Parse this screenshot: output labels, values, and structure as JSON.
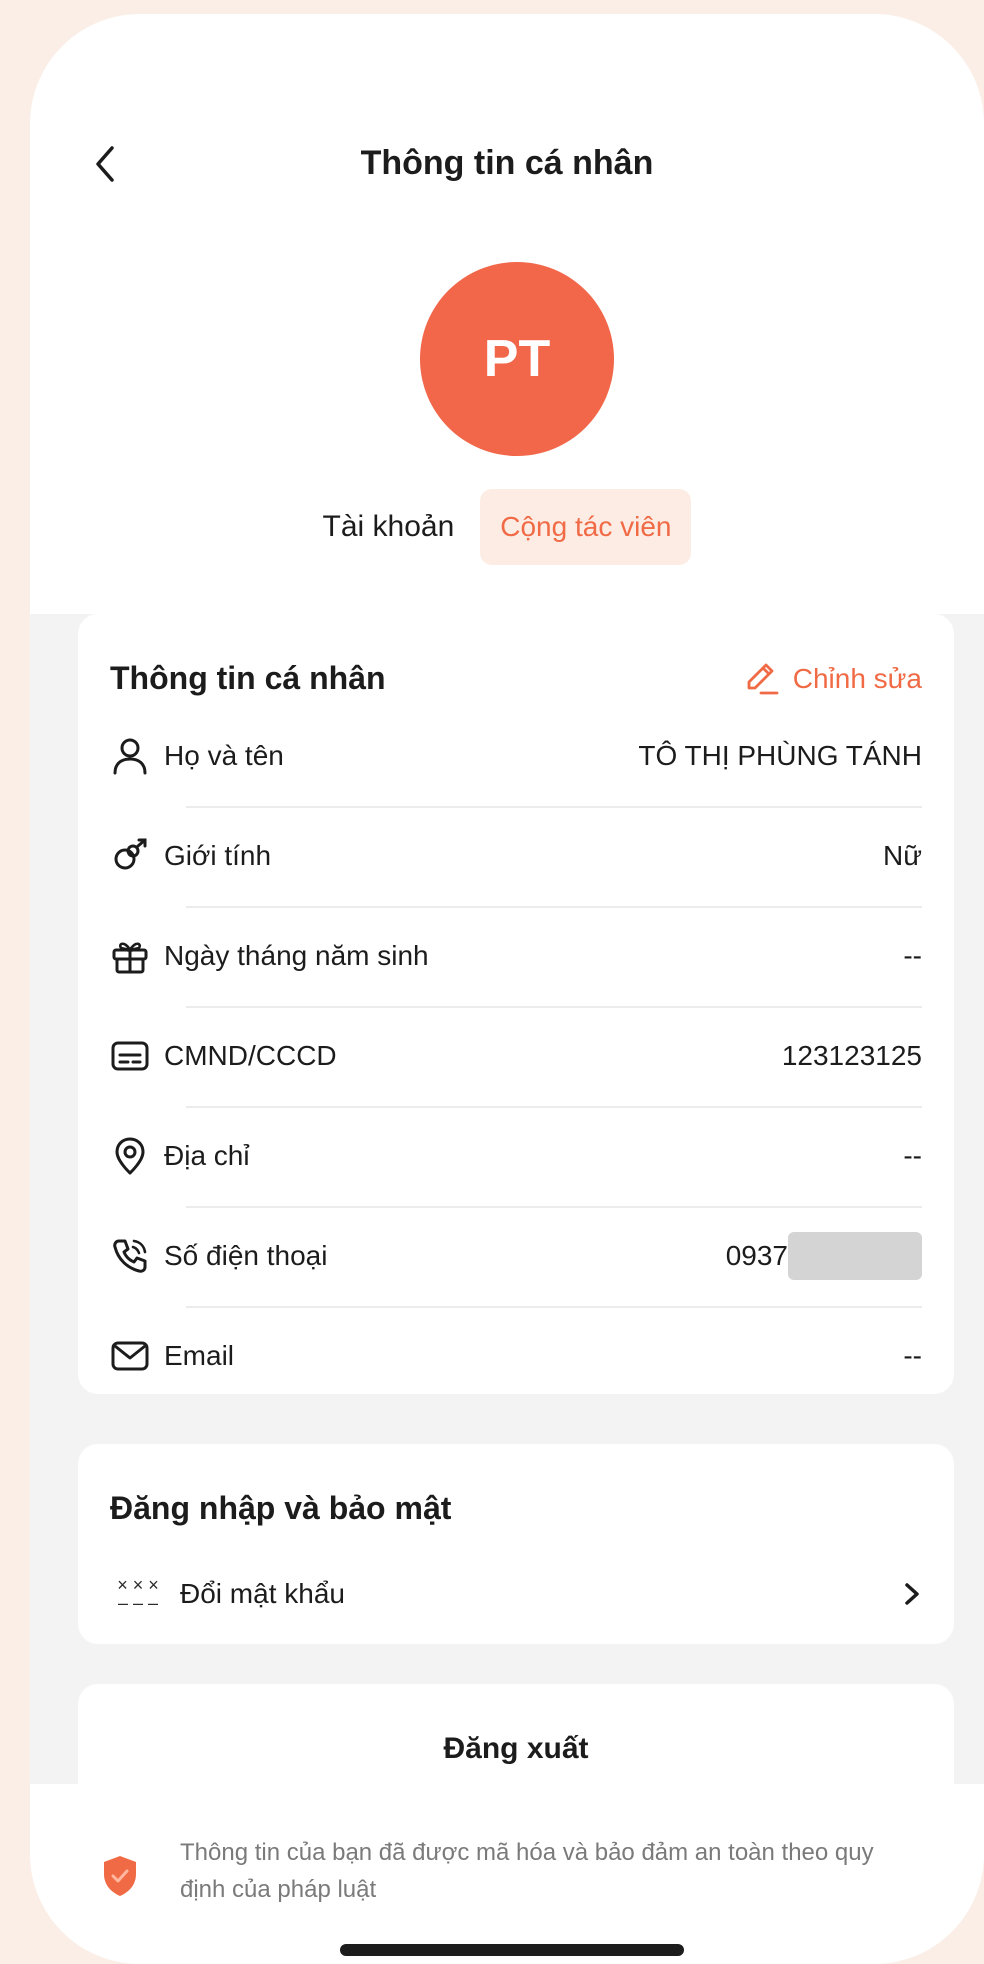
{
  "header": {
    "title": "Thông tin cá nhân",
    "back_icon": "chevron-left-icon"
  },
  "profile": {
    "initials": "PT",
    "account_label": "Tài khoản",
    "account_type": "Cộng tác viên",
    "avatar_color": "#f26649"
  },
  "personal_info": {
    "title": "Thông tin cá nhân",
    "edit_label": "Chỉnh sửa",
    "rows": [
      {
        "icon": "user-icon",
        "label": "Họ và tên",
        "value": "TÔ THỊ PHÙNG TÁNH"
      },
      {
        "icon": "gender-icon",
        "label": "Giới tính",
        "value": "Nữ"
      },
      {
        "icon": "gift-icon",
        "label": "Ngày tháng năm sinh",
        "value": "--"
      },
      {
        "icon": "id-card-icon",
        "label": "CMND/CCCD",
        "value": "123123125"
      },
      {
        "icon": "location-icon",
        "label": "Địa chỉ",
        "value": "--"
      },
      {
        "icon": "phone-icon",
        "label": "Số điện thoại",
        "value": "0937"
      },
      {
        "icon": "mail-icon",
        "label": "Email",
        "value": "--"
      }
    ]
  },
  "security": {
    "title": "Đăng nhập và bảo mật",
    "change_password": "Đổi mật khẩu"
  },
  "logout": {
    "label": "Đăng xuất"
  },
  "footer": {
    "text": "Thông tin của bạn đã được mã hóa và bảo đảm an toàn theo quy định của pháp luật"
  },
  "colors": {
    "accent": "#f06a45",
    "background": "#fbeee6"
  }
}
